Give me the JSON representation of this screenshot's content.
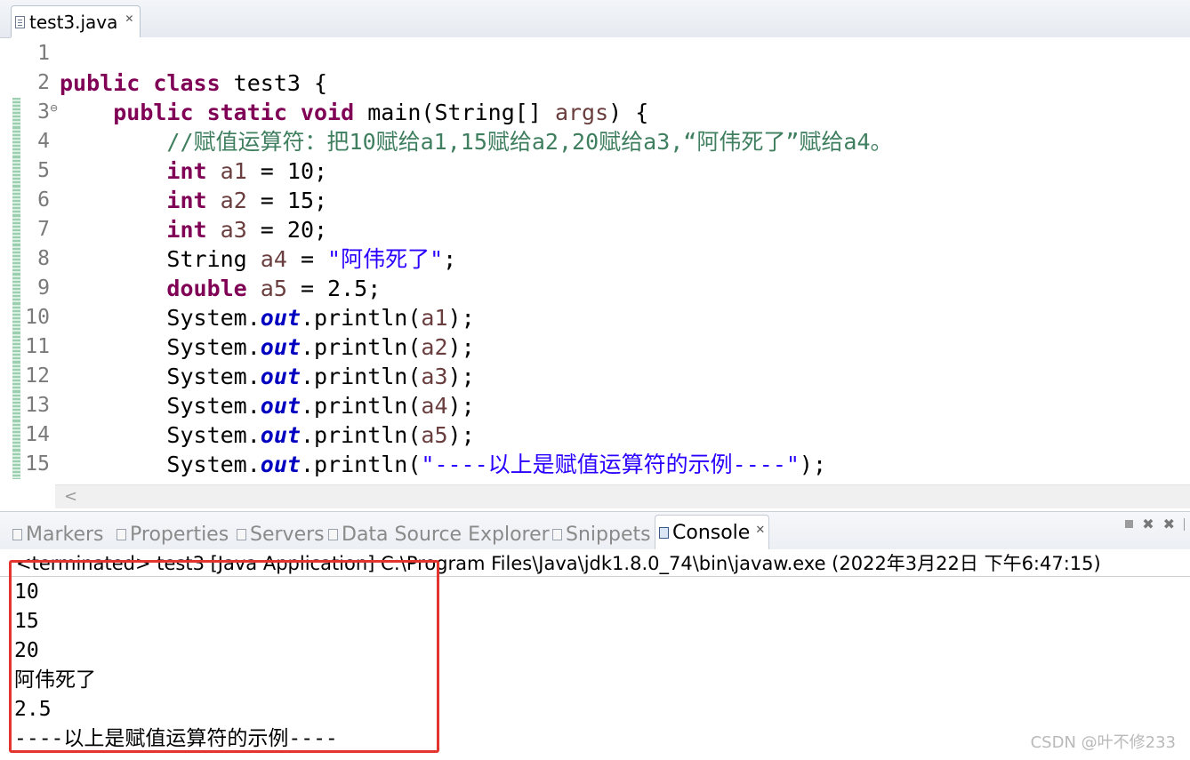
{
  "editor": {
    "tab_label": "test3.java",
    "tab_close": "✕",
    "lines": [
      {
        "n": "1"
      },
      {
        "n": "2"
      },
      {
        "n": "3",
        "fold": "⊖"
      },
      {
        "n": "4"
      },
      {
        "n": "5"
      },
      {
        "n": "6"
      },
      {
        "n": "7"
      },
      {
        "n": "8"
      },
      {
        "n": "9"
      },
      {
        "n": "10"
      },
      {
        "n": "11"
      },
      {
        "n": "12"
      },
      {
        "n": "13"
      },
      {
        "n": "14"
      },
      {
        "n": "15"
      }
    ],
    "code": {
      "l2": {
        "kw": "public class",
        "rest": " test3 {"
      },
      "l3": {
        "kw": "public static void",
        "rest": " main(String[] ",
        "var": "args",
        "tail": ") {"
      },
      "l4": {
        "comment": "//赋值运算符：把10赋给a1,15赋给a2,20赋给a3,“阿伟死了”赋给a4。"
      },
      "l5": {
        "kw": "int",
        "var": "a1",
        "rest": " = 10;"
      },
      "l6": {
        "kw": "int",
        "var": "a2",
        "rest": " = 15;"
      },
      "l7": {
        "kw": "int",
        "var": "a3",
        "rest": " = 20;"
      },
      "l8": {
        "type": "String ",
        "var": "a4",
        "mid": " = ",
        "str": "\"阿伟死了\"",
        "rest": ";"
      },
      "l9": {
        "kw": "double",
        "var": "a5",
        "rest": " = 2.5;"
      },
      "println_prefix": "System.",
      "out_field": "out",
      "println_call": ".println(",
      "l10": {
        "var": "a1",
        "rest": ");"
      },
      "l11": {
        "var": "a2",
        "rest": ");"
      },
      "l12": {
        "var": "a3",
        "rest": ");"
      },
      "l13": {
        "var": "a4",
        "rest": ");"
      },
      "l14": {
        "var": "a5",
        "rest": ");"
      },
      "l15": {
        "str": "\"----以上是赋值运算符的示例----\"",
        "rest": ");"
      }
    },
    "scroll_arrow": "<"
  },
  "panel": {
    "tabs": [
      {
        "label": "Markers"
      },
      {
        "label": "Properties"
      },
      {
        "label": "Servers"
      },
      {
        "label": "Data Source Explorer"
      },
      {
        "label": "Snippets"
      },
      {
        "label": "Console"
      }
    ],
    "console_close": "✕",
    "tool_remove": "✖",
    "tool_remove_all": "✖",
    "console_header": "<terminated> test3 [Java Application] C:\\Program Files\\Java\\jdk1.8.0_74\\bin\\javaw.exe (2022年3月22日 下午6:47:15)",
    "output": [
      "10",
      "15",
      "20",
      "阿伟死了",
      "2.5",
      "----以上是赋值运算符的示例----"
    ]
  },
  "watermark": "CSDN @叶不修233",
  "colors": {
    "keyword": "#7f0055",
    "comment": "#3f7f5f",
    "string": "#2a00ff",
    "field": "#0000c0",
    "highlight_box": "#e3342f"
  }
}
